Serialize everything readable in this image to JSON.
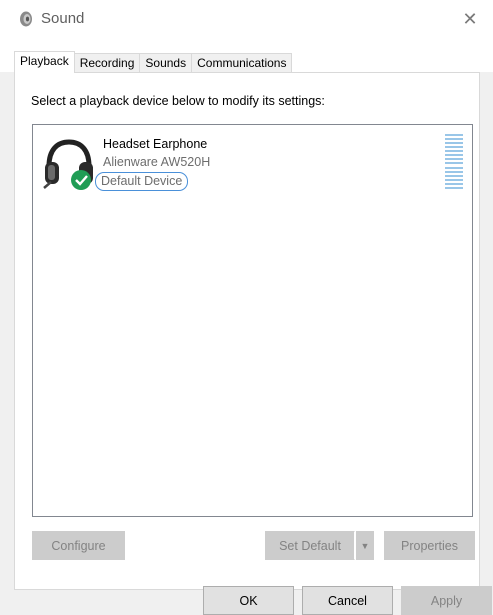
{
  "window": {
    "title": "Sound",
    "close_icon": "close-icon"
  },
  "tabs": [
    {
      "label": "Playback",
      "selected": true
    },
    {
      "label": "Recording",
      "selected": false
    },
    {
      "label": "Sounds",
      "selected": false
    },
    {
      "label": "Communications",
      "selected": false
    }
  ],
  "playback": {
    "instructions": "Select a playback device below to modify its settings:",
    "devices": [
      {
        "name": "Headset Earphone",
        "model": "Alienware AW520H",
        "status": "Default Device",
        "icon": "headset-icon",
        "badge_icon": "checkmark-icon"
      }
    ]
  },
  "buttons": {
    "configure": "Configure",
    "set_default": "Set Default",
    "properties": "Properties",
    "ok": "OK",
    "cancel": "Cancel",
    "apply": "Apply"
  },
  "colors": {
    "accent": "#4a90d9",
    "meter": "#99c6e8",
    "check_badge": "#1f9d55"
  }
}
